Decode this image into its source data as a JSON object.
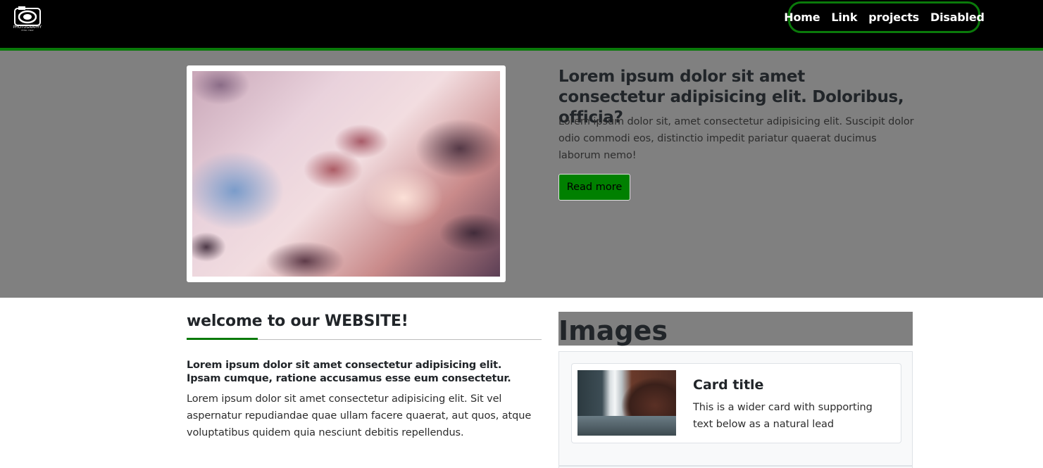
{
  "nav": {
    "logo_text": "PHOTOGRAPHY",
    "logo_sub": "PIXEL·VIEW",
    "links": [
      "Home",
      "Link",
      "projects",
      "Disabled"
    ],
    "accent_color": "#0a7a0a",
    "icon": "camera-icon"
  },
  "hero": {
    "image_alt": "sky-clouds",
    "title": "Lorem ipsum dolor sit amet consectetur adipisicing elit. Doloribus, officia?",
    "text": "Lorem ipsum dolor sit, amet consectetur adipisicing elit. Suscipit dolor odio commodi eos, distinctio impedit pariatur quaerat ducimus laborum nemo!",
    "button": "Read more",
    "button_color": "#008000"
  },
  "welcome": {
    "title": "welcome to our WEBSITE!",
    "lead": "Lorem ipsum dolor sit amet consectetur adipisicing elit. Ipsam cumque, ratione accusamus esse eum consectetur.",
    "body": "Lorem ipsum dolor sit amet consectetur adipisicing elit. Sit vel aspernatur repudiandae quae ullam facere quaerat, aut quos, atque voluptatibus quidem quia nesciunt debitis repellendus."
  },
  "images": {
    "title": "Images",
    "card": {
      "title": "Card title",
      "text": "This is a wider card with supporting text below as a natural lead"
    }
  }
}
